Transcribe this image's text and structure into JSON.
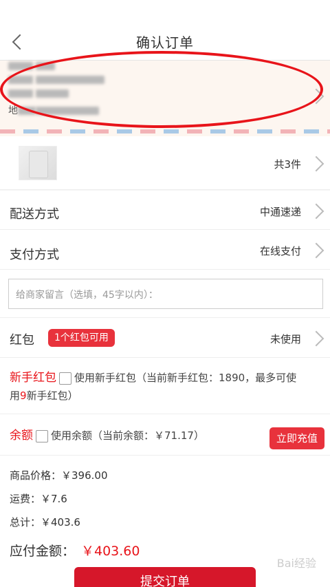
{
  "header": {
    "title": "确认订单"
  },
  "address": {
    "recipient_label": "联系人：",
    "phone_label": "电话：",
    "city_label": "广东省",
    "address_label": "地址："
  },
  "product": {
    "count": "共3件"
  },
  "delivery": {
    "label": "配送方式",
    "value": "中通速递"
  },
  "payment": {
    "label": "支付方式",
    "value": "在线支付"
  },
  "note": {
    "placeholder": "给商家留言（选填，45字以内）："
  },
  "coupon": {
    "label": "红包",
    "badge": "1个红包可用",
    "value": "未使用"
  },
  "new_user_coupon": {
    "label": "新手红包",
    "text_before": "使用新手红包（当前新手红包：1890，最多可使",
    "text_line2_prefix": "用",
    "highlight": "9",
    "text_line2_suffix": "新手红包）"
  },
  "balance": {
    "label": "余额",
    "text": "使用余额（当前余额：￥71.17）",
    "recharge_button": "立即充值"
  },
  "summary": {
    "goods_price": "商品价格：￥396.00",
    "shipping": "运费：￥7.6",
    "total": "总计：￥403.6",
    "pay_label": "应付金额：",
    "pay_value": "￥403.60"
  },
  "submit": {
    "label": "提交订单"
  },
  "watermark": {
    "text": "Bai经验"
  },
  "colors": {
    "accent": "#e8141a",
    "button": "#d6172a"
  }
}
